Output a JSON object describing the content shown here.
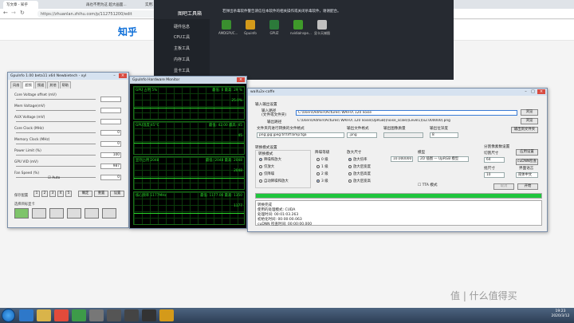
{
  "browser": {
    "tabs": [
      {
        "label": "写文章 - 知乎"
      },
      {
        "label": "再也不用为这 超大画面..."
      },
      {
        "label": "实用工具 | 超清大图画质增强..."
      }
    ],
    "url": "https://zhuanlan.zhihu.com/p/112751200/edit",
    "site_logo": "知乎"
  },
  "toolbox": {
    "title": "图吧工具箱",
    "notice": "若弹出杀毒软件警告请信任本软件的相关操作或关闭杀毒软件，谢谢配合。",
    "side": [
      "硬件信息",
      "CPU工具",
      "主板工具",
      "内存工具",
      "显卡工具"
    ],
    "icons": [
      {
        "label": "AMDGPUC...",
        "color": "#3a8f2f",
        "icon": "amd-icon"
      },
      {
        "label": "Gpuinfo",
        "color": "#d49a1a",
        "icon": "gpuinfo-icon"
      },
      {
        "label": "GPUZ",
        "color": "#2c7a3a",
        "icon": "gpuz-icon"
      },
      {
        "label": "nvidiaInspe...",
        "color": "#3f9a2a",
        "icon": "nvidia-icon"
      },
      {
        "label": "显卡天梯图",
        "color": "#c0c0c0",
        "icon": "ladder-icon"
      }
    ]
  },
  "gpuinfo": {
    "title": "GpuInfo 1.00 beta11 x64 Newbietech - xyl",
    "tabs": [
      "风扇",
      "超频",
      "频道",
      "其他",
      "帮助"
    ],
    "sliders": [
      {
        "label": "Core Voltage offset (mV)",
        "value": ""
      },
      {
        "label": "Mem Voltage(mV)",
        "value": ""
      },
      {
        "label": "AUX Voltage (mV)",
        "value": ""
      },
      {
        "label": "Core Clock (MHz)",
        "value": "0"
      },
      {
        "label": "Memory Clock (MHz)",
        "value": "0"
      },
      {
        "label": "Power Limit (%)",
        "value": "100"
      },
      {
        "label": "GPU VID (mV)",
        "value": "987"
      },
      {
        "label": "Fan Speed (%)",
        "value": "0"
      }
    ],
    "auto_label": "Auto",
    "profile_label": "保存配置",
    "profiles": [
      "1",
      "2",
      "3",
      "4",
      "5"
    ],
    "buttons": [
      "确定",
      "重置",
      "设置"
    ],
    "monitors_label": "选择目标显卡"
  },
  "hwmon": {
    "title": "GpuInfo Hardware Monitor",
    "panels": [
      {
        "left": "GPU 占用 5%",
        "right": "最低: 0 最高: 29 %",
        "readout": "25.0%"
      },
      {
        "left": "GPU温度 45°C",
        "right": "最低: 42.00 最高: 45",
        "readout": "45"
      },
      {
        "left": "显存占用 2048",
        "right": "最低: 2048 最高: 2048",
        "readout": "2048"
      },
      {
        "left": "核心频率 1177MHz",
        "right": "最低: 1177.00 最高: 1350",
        "readout": "1177"
      }
    ]
  },
  "waifu": {
    "title": "waifu2x-caffe",
    "io_header": "输入输出设置",
    "input_label": "输入路径\n(文件或文件夹)",
    "input_value": "C:\\Users\\Admin\\Pictures\\ WAIFU\\ 120 noise",
    "output_label": "输出路径",
    "output_value": "C:\\Users\\Admin\\Pictures\\ WAIFU\\ 120 noise(UpRGB)(noise_scale)(Level1)(x2.000000).png",
    "browse": "浏览",
    "ext_label": "文件夹内进行转换的文件格式",
    "ext_value": "png:jpg:jpeg:tif:tiff:bmp:tga",
    "fmt_label": "输出文件格式",
    "fmt_value": ".png",
    "quality_label": "输出图像质量",
    "depth_label": "输出位深度",
    "depth_value": "8",
    "open_folder": "输出到文件夹",
    "conv_header": "转换模式设置",
    "conv_sub": "转换模式",
    "conv_modes": [
      "降噪和放大",
      "仅放大",
      "仅降噪",
      "自动降噪和放大"
    ],
    "noise_header": "降噪等级",
    "noise_levels": [
      "0 级",
      "1 级",
      "2 级",
      "3 级"
    ],
    "scale_header": "放大尺寸",
    "scale_opts": [
      "放大倍率",
      "放大后宽度",
      "放大后高度",
      "放大后宽高"
    ],
    "scale_value": "10.000000",
    "model_header": "模型",
    "model_value": "2D 插图 — UpRGB 模型",
    "tta_label": "TTA 模式",
    "split_header": "切割尺寸",
    "split_value": "64",
    "batch_header": "批尺寸",
    "batch_value": "10",
    "lang_header": "界面语言",
    "lang_value": "简体中文",
    "proc_header": "分割像素数设置",
    "btn_app": "应用设置",
    "btn_cudnn": "cuDNN检查",
    "btn_cancel": "取消",
    "btn_start": "开始",
    "progress": 1.0,
    "log": [
      "转换完成",
      "使用的处理模式: CUDA",
      "处理时间: 00:01:03.263",
      "初始化时间: 00:00:00.063",
      "cuDNN 检查时间: 00:00:00.000"
    ]
  },
  "taskbar": {
    "time": "19:23",
    "date": "2020/3/12"
  },
  "watermark": "值 | 什么值得买"
}
